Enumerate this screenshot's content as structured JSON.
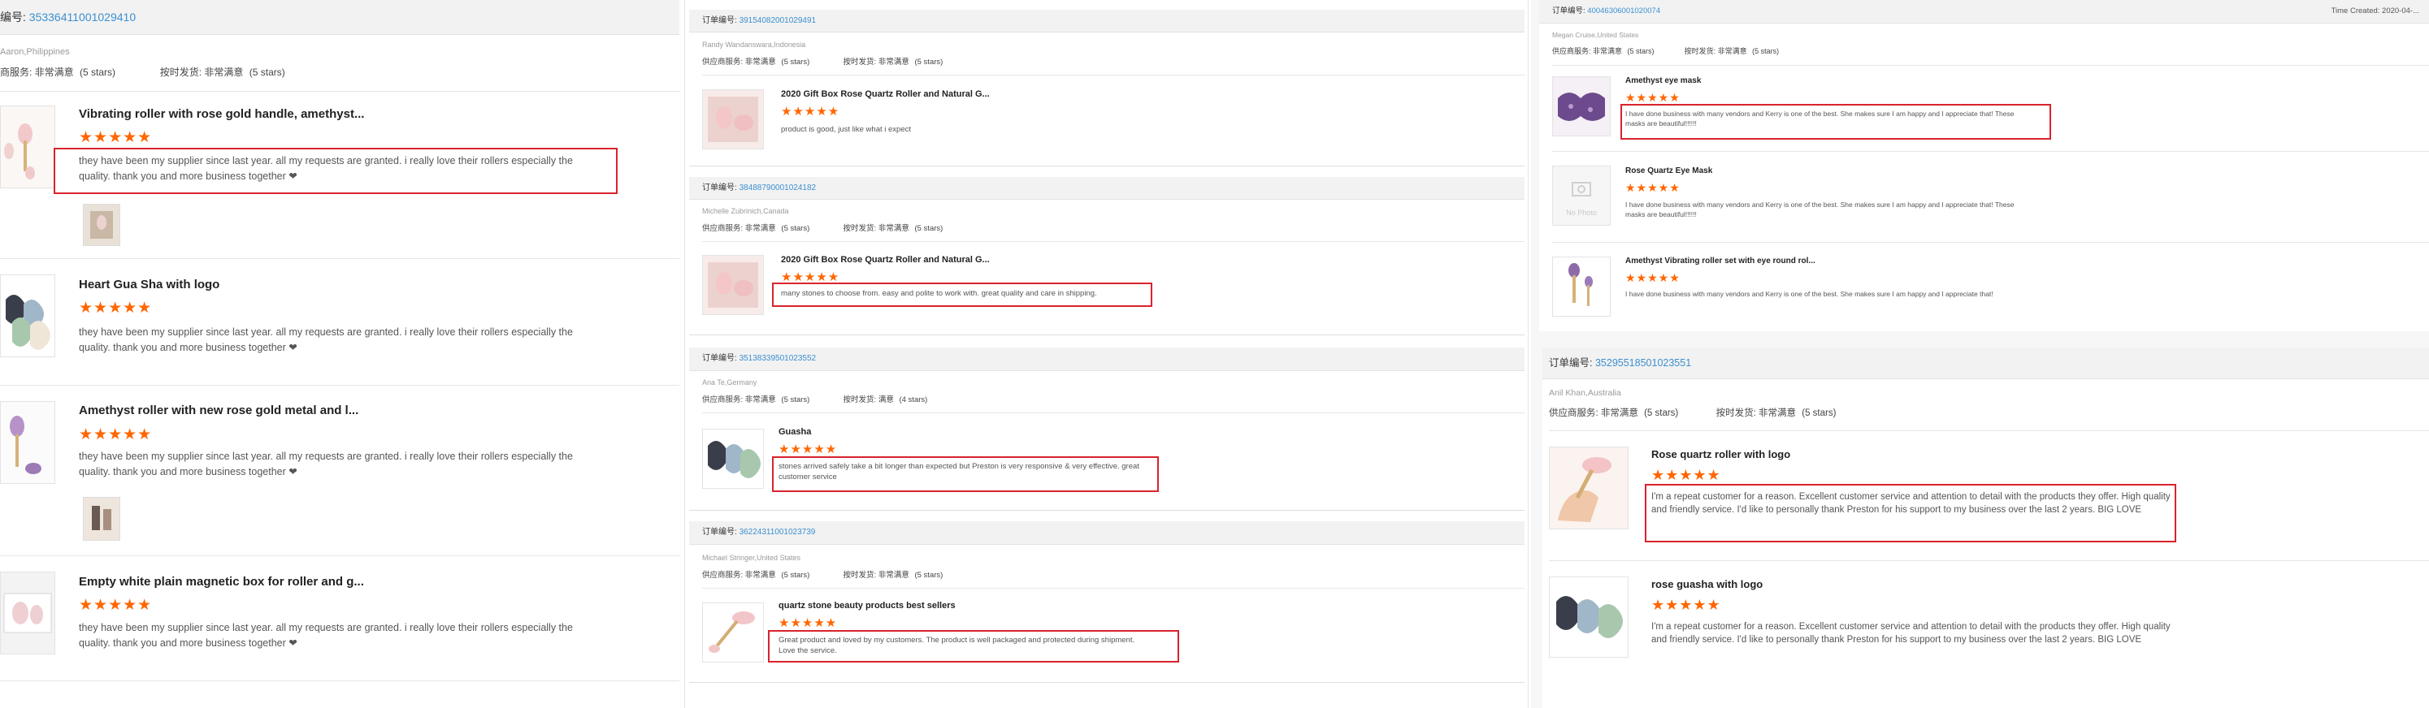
{
  "colors": {
    "order_link": "#3b8fd0",
    "star": "#ff6600",
    "highlight": "#d9232d",
    "header_bg": "#f2f2f2"
  },
  "labels": {
    "order_prefix": "订单编号:",
    "rating_supplier": "供应商服务: 非常满意",
    "rating_supplier_short": "供应商服务:",
    "rating_ontime": "按时发货: 非常满意",
    "rating_ontime_short": "按时发货:",
    "very_satisfied": "非常满意",
    "five_stars": "(5 stars)"
  },
  "left": {
    "order_label": "编号:",
    "order_no": "3533641100102941​0",
    "buyer": "Aaron,Philippines",
    "supplier_rating": "商服务: 非常满意",
    "supplier_stars": "(5 stars)",
    "ontime_rating": "按时发货: 非常满意",
    "ontime_stars": "(5 stars)",
    "items": [
      {
        "name": "Vibrating roller with rose gold handle, amethyst...",
        "stars": "★★★★★",
        "review": "they have been my supplier since last year. all my requests are granted. i really love their rollers especially the quality. thank you and more business together ❤",
        "thumb_icon": "roller-photo"
      },
      {
        "name": "Heart Gua Sha with logo",
        "stars": "★★★★★",
        "review": "they have been my supplier since last year. all my requests are granted. i really love their rollers especially the quality. thank you and more business together ❤",
        "thumb_icon": "guasha-photo"
      },
      {
        "name": "Amethyst roller with new rose gold metal and l...",
        "stars": "★★★★★",
        "review": "they have been my supplier since last year. all my requests are granted. i really love their rollers especially the quality. thank you and more business together ❤",
        "thumb_icon": "amethyst-roller-photo"
      },
      {
        "name": "Empty white plain magnetic box for roller and g...",
        "stars": "★★★★★",
        "review": "they have been my supplier since last year. all my requests are granted. i really love their rollers especially the quality. thank you and more business together ❤",
        "thumb_icon": "box-photo"
      }
    ]
  },
  "middle": {
    "orders": [
      {
        "order_label": "订单编号:",
        "order_no": "3915408200102949​1",
        "buyer": "Randy Wandanswara,Indonesia",
        "supplier": "供应商服务: 非常满意",
        "supplier_stars": "(5 stars)",
        "ontime": "按时发货: 非常满意",
        "ontime_stars": "(5 stars)",
        "item": {
          "name": "2020 Gift Box Rose Quartz Roller and Natural G...",
          "stars": "★★★★★",
          "review": "product is good, just like what i expect"
        }
      },
      {
        "order_label": "订单编号:",
        "order_no": "3848879000102418​2",
        "buyer": "Michelle Zubrinich,Canada",
        "supplier": "供应商服务: 非常满意",
        "supplier_stars": "(5 stars)",
        "ontime": "按时发货: 非常满意",
        "ontime_stars": "(5 stars)",
        "item": {
          "name": "2020 Gift Box Rose Quartz Roller and Natural G...",
          "stars": "★★★★★",
          "review": "many stones to choose from. easy and polite to work with. great quality and care in shipping."
        }
      },
      {
        "order_label": "订单编号:",
        "order_no": "3513833950102355​2",
        "buyer": "Ana Te,Germany",
        "supplier": "供应商服务: 非常满意",
        "supplier_stars": "(5 stars)",
        "ontime": "按时发货: 满意",
        "ontime_stars": "(4 stars)",
        "item": {
          "name": "Guasha",
          "stars": "★★★★★",
          "review": "stones arrived safely take a bit longer than expected but Preston is very responsive & very effective. great customer service"
        }
      },
      {
        "order_label": "订单编号:",
        "order_no": "3622431100102373​9",
        "buyer": "Michael Stringer,United States",
        "supplier": "供应商服务: 非常满意",
        "supplier_stars": "(5 stars)",
        "ontime": "按时发货: 非常满意",
        "ontime_stars": "(5 stars)",
        "item": {
          "name": "quartz stone beauty products best sellers",
          "stars": "★★★★★",
          "review": "Great product and loved by my customers. The product is well packaged and protected during shipment. Love the service."
        }
      }
    ]
  },
  "right": {
    "order1": {
      "order_label": "订单编号:",
      "order_no": "4004630600102007​4",
      "time_created": "Time Created: 2020-04-...",
      "buyer": "Megan Cruise,United States",
      "supplier": "供应商服务: 非常满意",
      "supplier_stars": "(5 stars)",
      "ontime": "按时发货: 非常满意",
      "ontime_stars": "(5 stars)",
      "items": [
        {
          "name": "Amethyst eye mask",
          "stars": "★★★★★",
          "review": "I have done business with many vendors and Kerry is one of the best. She makes sure I am happy and I appreciate that! These masks are beautiful!!!!!!"
        },
        {
          "name": "Rose Quartz Eye Mask",
          "stars": "★★★★★",
          "review": "I have done business with many vendors and Kerry is one of the best. She makes sure I am happy and I appreciate that! These masks are beautiful!!!!!!",
          "no_photo": "No Photo"
        },
        {
          "name": "Amethyst Vibrating roller set with eye round rol...",
          "stars": "★★★★★",
          "review": "I have done business with many vendors and Kerry is one of the best. She makes sure I am happy and I appreciate that!"
        }
      ]
    },
    "order2": {
      "order_label": "订单编号:",
      "order_no": "3529551850102355​1",
      "buyer": "Anil Khan,Australia",
      "supplier": "供应商服务: 非常满意",
      "supplier_stars": "(5 stars)",
      "ontime": "按时发货: 非常满意",
      "ontime_stars": "(5 stars)",
      "items": [
        {
          "name": "Rose quartz roller with logo",
          "stars": "★★★★★",
          "review": "I'm a repeat customer for a reason. Excellent customer service and attention to detail with the products they offer. High quality and friendly service. I'd like to personally thank Preston for his support to my business over the last 2 years. BIG LOVE"
        },
        {
          "name": "rose guasha with logo",
          "stars": "★★★★★",
          "review": "I'm a repeat customer for a reason. Excellent customer service and attention to detail with the products they offer. High quality and friendly service. I'd like to personally thank Preston for his support to my business over the last 2 years. BIG LOVE"
        }
      ]
    }
  }
}
